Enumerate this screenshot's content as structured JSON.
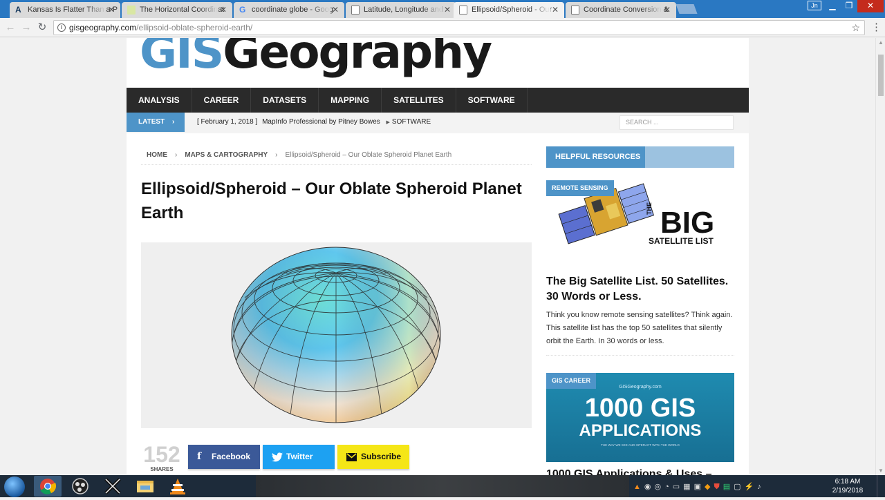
{
  "browser": {
    "tabs": [
      {
        "title": "Kansas Is Flatter Than a P",
        "icon": "a",
        "active": false
      },
      {
        "title": "The Horizontal Coordinat",
        "icon": "m",
        "active": false
      },
      {
        "title": "coordinate globe - Goog",
        "icon": "g",
        "active": false
      },
      {
        "title": "Latitude, Longitude and",
        "icon": "doc",
        "active": false
      },
      {
        "title": "Ellipsoid/Spheroid - Our",
        "icon": "doc",
        "active": true
      },
      {
        "title": "Coordinate Conversion &",
        "icon": "doc",
        "active": false
      }
    ],
    "url_host": "gisgeography.com",
    "url_path": "/ellipsoid-oblate-spheroid-earth/",
    "user_badge": "Jn"
  },
  "site": {
    "logo_gis": "GIS",
    "logo_geo": "Geography",
    "nav": [
      "ANALYSIS",
      "CAREER",
      "DATASETS",
      "MAPPING",
      "SATELLITES",
      "SOFTWARE"
    ],
    "latest_label": "LATEST",
    "ticker_date": "[ February 1, 2018 ]",
    "ticker_title": "MapInfo Professional by Pitney Bowes",
    "ticker_category": "SOFTWARE",
    "search_placeholder": "SEARCH ..."
  },
  "breadcrumb": {
    "home": "HOME",
    "category": "MAPS & CARTOGRAPHY",
    "current": "Ellipsoid/Spheroid – Our Oblate Spheroid Planet Earth"
  },
  "article": {
    "title": "Ellipsoid/Spheroid – Our Oblate Spheroid Planet Earth",
    "share_count": "152",
    "shares_label": "SHARES",
    "facebook": "Facebook",
    "twitter": "Twitter",
    "subscribe": "Subscribe"
  },
  "sidebar": {
    "widget_title": "HELPFUL RESOURCES",
    "card1": {
      "tag": "REMOTE SENSING",
      "image_line1": "THE",
      "image_line2": "BIG",
      "image_line3": "SATELLITE LIST",
      "title": "The Big Satellite List. 50 Satellites. 30 Words or Less.",
      "text": "Think you know remote sensing satellites? Think again. This satellite list has the top 50 satellites that silently orbit the Earth. In 30 words or less."
    },
    "card2": {
      "tag": "GIS CAREER",
      "image_site": "GISGeography.com",
      "image_line1": "1000 GIS",
      "image_line2": "APPLICATIONS",
      "image_small": "THE WAY WE SEE AND INTERACT WITH THE WORLD",
      "title": "1000 GIS Applications & Uses –"
    }
  },
  "taskbar": {
    "time": "6:18 AM",
    "date": "2/19/2018"
  },
  "colors": {
    "brand_blue": "#4e94c8",
    "nav_dark": "#2a2a2a",
    "facebook": "#3b5998",
    "twitter": "#1da1f2",
    "subscribe": "#f5e617"
  }
}
